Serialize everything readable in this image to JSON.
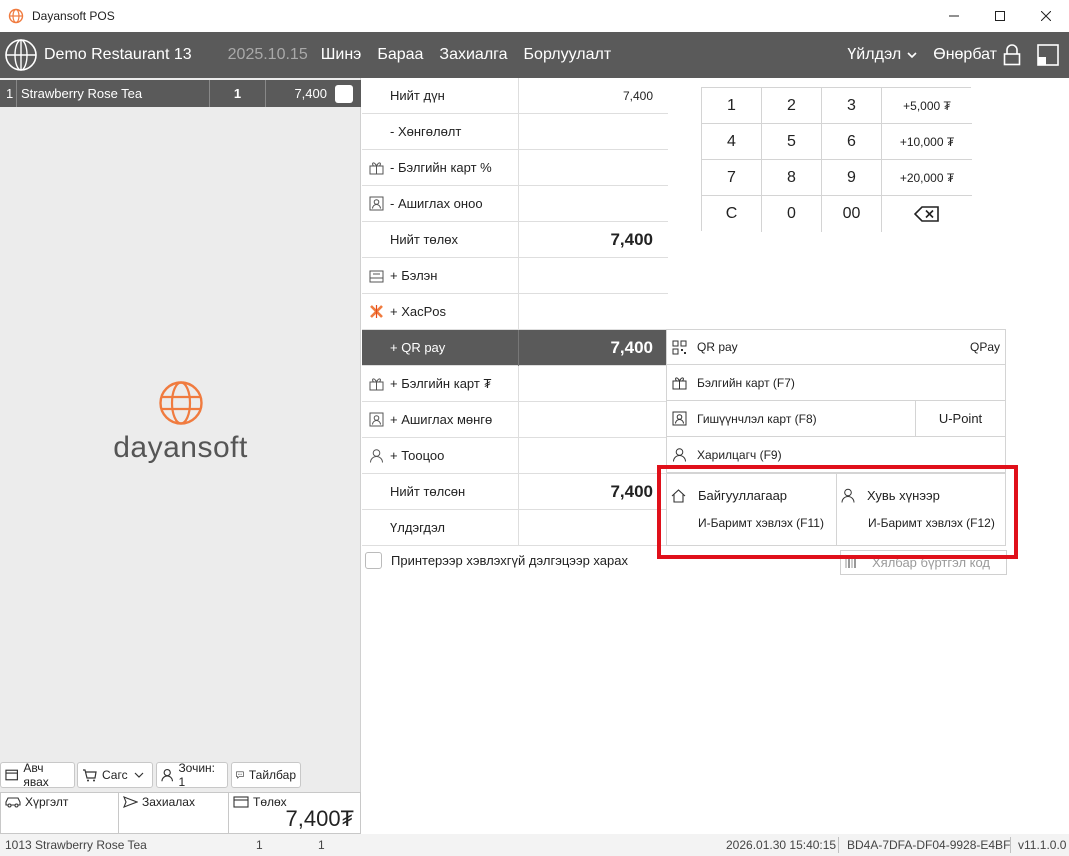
{
  "window": {
    "title": "Dayansoft POS"
  },
  "header": {
    "restaurant": "Demo Restaurant 13",
    "date": "2025.10.15",
    "nav": [
      "Шинэ",
      "Бараа",
      "Захиалга",
      "Борлуулалт"
    ],
    "more": "Үйлдэл",
    "user": "Өнөрбат"
  },
  "order": {
    "no": "1",
    "name": "Strawberry Rose Tea",
    "qty": "1",
    "price": "7,400"
  },
  "brand": {
    "name": "dayansoft"
  },
  "left_buttons": {
    "takeaway": "Авч явах",
    "basket": "Сагс",
    "guests": "Зочин: 1",
    "note": "Тайлбар"
  },
  "bottom_buttons": {
    "delivery": "Хүргэлт",
    "order": "Захиалах",
    "pay": "Төлөх",
    "total": "7,400₮"
  },
  "payments": [
    {
      "label": "Нийт дүн",
      "value": "7,400",
      "icon": ""
    },
    {
      "label": "- Хөнгөлөлт",
      "value": "",
      "icon": ""
    },
    {
      "label": "- Бэлгийн карт %",
      "value": "",
      "icon": "gift-card-icon"
    },
    {
      "label": "- Ашиглах оноо",
      "value": "",
      "icon": "member-card-icon"
    },
    {
      "label": "Нийт төлөх",
      "value": "7,400",
      "icon": ""
    },
    {
      "label": "+ Бэлэн",
      "value": "",
      "icon": "cash-icon"
    },
    {
      "label": "+ ХасPos",
      "value": "",
      "icon": "xacpos-icon"
    },
    {
      "label": "+ QR pay",
      "value": "7,400",
      "icon": ""
    },
    {
      "label": "+ Бэлгийн карт ₮",
      "value": "",
      "icon": "gift-card-icon"
    },
    {
      "label": "+ Ашиглах мөнгө",
      "value": "",
      "icon": "member-card-icon"
    },
    {
      "label": "+ Тооцоо",
      "value": "",
      "icon": "person-icon"
    },
    {
      "label": "Нийт төлсөн",
      "value": "7,400",
      "icon": ""
    },
    {
      "label": "Үлдэгдэл",
      "value": "",
      "icon": ""
    }
  ],
  "printer_toggle": "Принтерээр хэвлэхгүй дэлгэцээр харах",
  "numpad": [
    "1",
    "2",
    "3",
    "+5,000 ₮",
    "4",
    "5",
    "6",
    "+10,000 ₮",
    "7",
    "8",
    "9",
    "+20,000 ₮",
    "C",
    "0",
    "00",
    ""
  ],
  "methods": {
    "qr": "QR pay",
    "qr_provider": "QPay",
    "gift": "Бэлгийн карт (F7)",
    "member": "Гишүүнчлэл карт (F8)",
    "upoint": "U-Point",
    "customer": "Харилцагч (F9)"
  },
  "ebarimt": {
    "org": "Байгууллагаар",
    "org_sub": "И-Баримт хэвлэх (F11)",
    "person": "Хувь хүнээр",
    "person_sub": "И-Баримт хэвлэх (F12)"
  },
  "barcode_placeholder": "Хялбар бүртгэл код",
  "status": {
    "item": "1013 Strawberry Rose Tea",
    "qty": "1",
    "count": "1",
    "datetime": "2026.01.30 15:40:15",
    "device": "BD4A-7DFA-DF04-9928-E4BF",
    "version": "v11.1.0.0"
  },
  "colors": {
    "header": "#5a5a5a",
    "brand_orange": "#f07b3f",
    "highlight": "#e0101a"
  }
}
